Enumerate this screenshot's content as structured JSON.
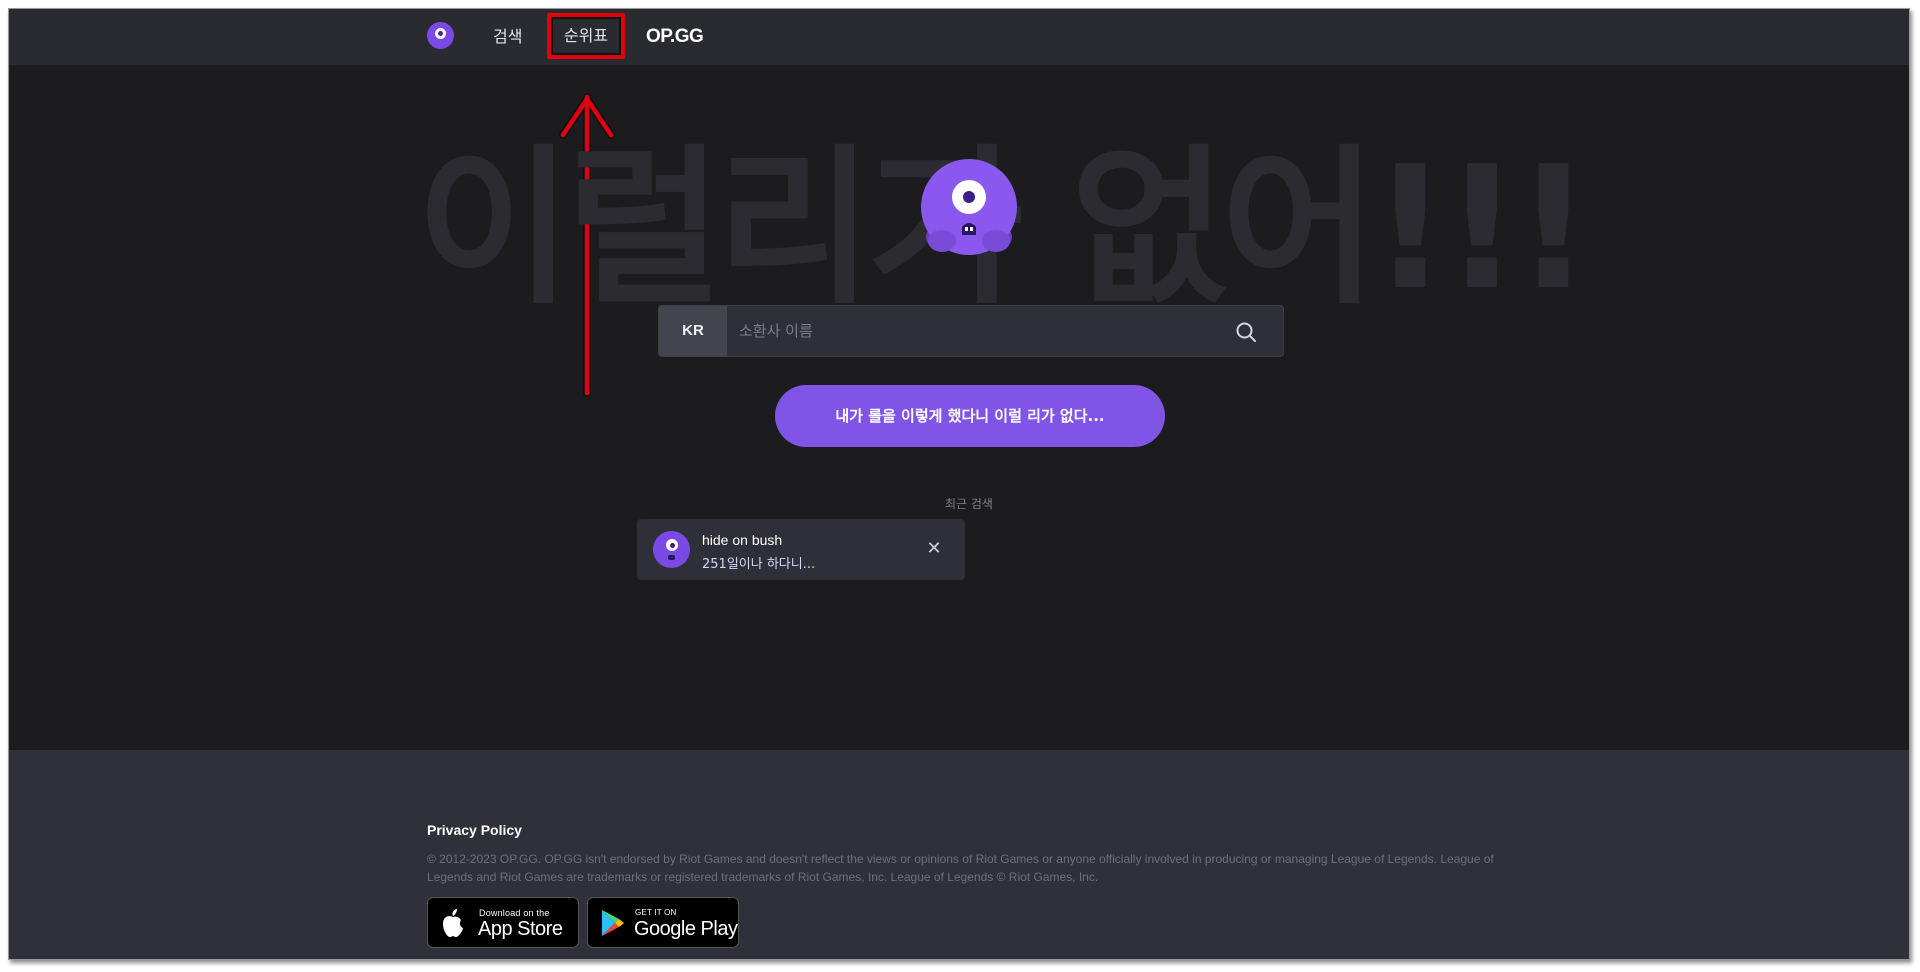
{
  "nav": {
    "search_label": "검색",
    "ranking_label": "순위표",
    "brand": "OP.GG"
  },
  "hero": {
    "background_text": "이럴리가 없어!!!",
    "region": "KR",
    "search_placeholder": "소환사 이름",
    "cta_label": "내가 롤을 이렇게 했다니 이럴 리가 없다..."
  },
  "recent": {
    "label": "최근 검색",
    "items": [
      {
        "name": "hide on bush",
        "subtitle": "251일이나 하다니..."
      }
    ]
  },
  "footer": {
    "privacy": "Privacy Policy",
    "copyright": "© 2012-2023 OP.GG. OP.GG isn't endorsed by Riot Games and doesn't reflect the views or opinions of Riot Games or anyone officially involved in producing or managing League of Legends. League of Legends and Riot Games are trademarks or registered trademarks of Riot Games, Inc. League of Legends © Riot Games, Inc.",
    "appstore_small": "Download on the",
    "appstore_big": "App Store",
    "googleplay_small": "GET IT ON",
    "googleplay_big": "Google Play"
  },
  "colors": {
    "accent": "#8154e8",
    "background": "#1c1c1f",
    "nav": "#2a2a31",
    "annotation": "#e00012"
  },
  "icons": [
    "mascot-icon",
    "search-icon",
    "close-icon",
    "apple-icon",
    "google-play-icon",
    "annotation-arrow"
  ]
}
